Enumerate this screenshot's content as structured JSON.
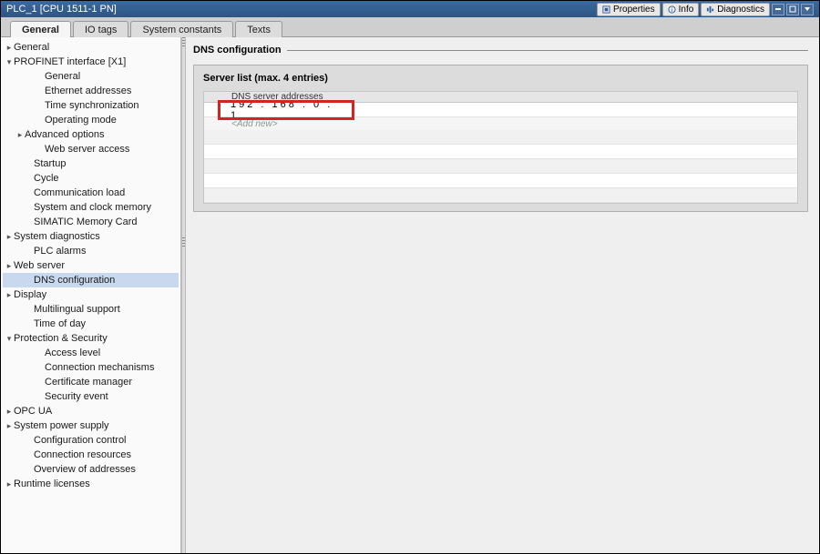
{
  "titlebar": {
    "title": "PLC_1 [CPU 1511-1 PN]",
    "buttons": {
      "properties": "Properties",
      "info": "Info",
      "diagnostics": "Diagnostics"
    }
  },
  "tabs": {
    "general": "General",
    "iotags": "IO tags",
    "sysconst": "System constants",
    "texts": "Texts"
  },
  "tree": [
    {
      "label": "General",
      "indent": 0,
      "tri": "right"
    },
    {
      "label": "PROFINET interface [X1]",
      "indent": 0,
      "tri": "down"
    },
    {
      "label": "General",
      "indent": 2
    },
    {
      "label": "Ethernet addresses",
      "indent": 2
    },
    {
      "label": "Time synchronization",
      "indent": 2
    },
    {
      "label": "Operating mode",
      "indent": 2
    },
    {
      "label": "Advanced options",
      "indent": 1,
      "tri": "right"
    },
    {
      "label": "Web server access",
      "indent": 2
    },
    {
      "label": "Startup",
      "indent": 1
    },
    {
      "label": "Cycle",
      "indent": 1
    },
    {
      "label": "Communication load",
      "indent": 1
    },
    {
      "label": "System and clock memory",
      "indent": 1
    },
    {
      "label": "SIMATIC Memory Card",
      "indent": 1
    },
    {
      "label": "System diagnostics",
      "indent": 0,
      "tri": "right"
    },
    {
      "label": "PLC alarms",
      "indent": 1
    },
    {
      "label": "Web server",
      "indent": 0,
      "tri": "right"
    },
    {
      "label": "DNS configuration",
      "indent": 1,
      "selected": true
    },
    {
      "label": "Display",
      "indent": 0,
      "tri": "right"
    },
    {
      "label": "Multilingual support",
      "indent": 1
    },
    {
      "label": "Time of day",
      "indent": 1
    },
    {
      "label": "Protection & Security",
      "indent": 0,
      "tri": "down"
    },
    {
      "label": "Access level",
      "indent": 2
    },
    {
      "label": "Connection mechanisms",
      "indent": 2
    },
    {
      "label": "Certificate manager",
      "indent": 2
    },
    {
      "label": "Security event",
      "indent": 2
    },
    {
      "label": "OPC UA",
      "indent": 0,
      "tri": "right"
    },
    {
      "label": "System power supply",
      "indent": 0,
      "tri": "right"
    },
    {
      "label": "Configuration control",
      "indent": 1
    },
    {
      "label": "Connection resources",
      "indent": 1
    },
    {
      "label": "Overview of addresses",
      "indent": 1
    },
    {
      "label": "Runtime licenses",
      "indent": 0,
      "tri": "right"
    }
  ],
  "content": {
    "heading": "DNS configuration",
    "panel_title": "Server list (max. 4 entries)",
    "table": {
      "header": "DNS server addresses",
      "rows": [
        {
          "value": "192 . 168 . 0   . 1"
        }
      ],
      "addnew": "<Add new>"
    }
  }
}
